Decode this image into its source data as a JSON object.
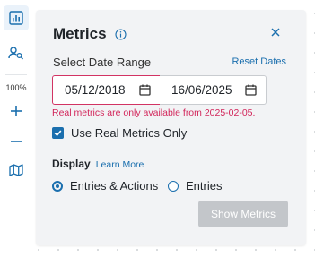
{
  "toolbar": {
    "zoom_level": "100%",
    "tools": [
      {
        "name": "metrics",
        "icon": "bar-chart-icon",
        "active": true
      },
      {
        "name": "user-search",
        "icon": "user-search-icon",
        "active": false
      },
      {
        "name": "zoom-in",
        "icon": "plus-icon",
        "active": false
      },
      {
        "name": "zoom-out",
        "icon": "minus-icon",
        "active": false
      },
      {
        "name": "map",
        "icon": "map-icon",
        "active": false
      }
    ]
  },
  "panel": {
    "title": "Metrics",
    "date_range_label": "Select Date Range",
    "reset_label": "Reset Dates",
    "start_date": "05/12/2018",
    "end_date": "16/06/2025",
    "error_message": "Real metrics are only available from 2025-02-05.",
    "real_metrics_only": {
      "label": "Use Real Metrics Only",
      "checked": true
    },
    "display": {
      "label": "Display",
      "learn_more": "Learn More",
      "options": [
        {
          "label": "Entries & Actions",
          "selected": true
        },
        {
          "label": "Entries",
          "selected": false
        }
      ]
    },
    "submit_label": "Show Metrics"
  },
  "colors": {
    "accent": "#1b6fae",
    "error": "#d2255a",
    "disabled_button": "#c3c6ca",
    "panel_bg": "#f2f3f5"
  }
}
